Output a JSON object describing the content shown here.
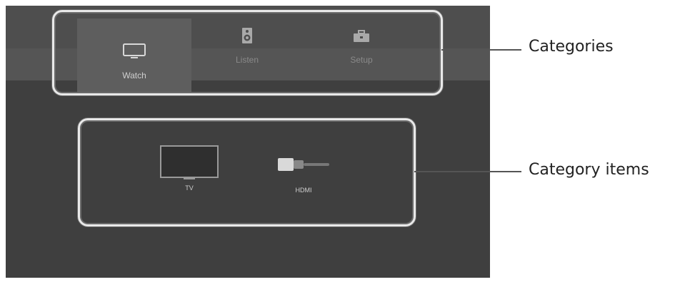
{
  "categories": [
    {
      "label": "Watch",
      "icon": "tv-icon",
      "active": true
    },
    {
      "label": "Listen",
      "icon": "speaker-icon",
      "active": false
    },
    {
      "label": "Setup",
      "icon": "toolbox-icon",
      "active": false
    }
  ],
  "category_items": [
    {
      "label": "TV",
      "icon": "tv-screen-icon"
    },
    {
      "label": "HDMI",
      "icon": "hdmi-cable-icon"
    }
  ],
  "callouts": {
    "categories": "Categories",
    "category_items": "Category items"
  },
  "colors": {
    "screen_bg": "#3f3f3f",
    "callout_border": "#e9e9e9"
  }
}
